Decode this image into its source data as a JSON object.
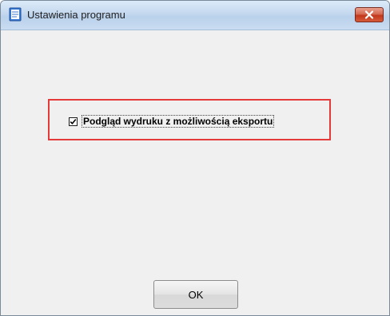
{
  "window": {
    "title": "Ustawienia programu",
    "icon": "notepad-icon",
    "close_icon": "close-x-icon"
  },
  "settings": {
    "print_preview_export": {
      "label": "Podgląd wydruku z możliwością eksportu",
      "checked": true
    }
  },
  "buttons": {
    "ok_label": "OK"
  },
  "colors": {
    "highlight_border": "#e53a3a",
    "close_button": "#c2381c",
    "window_background": "#f0f0f0"
  }
}
